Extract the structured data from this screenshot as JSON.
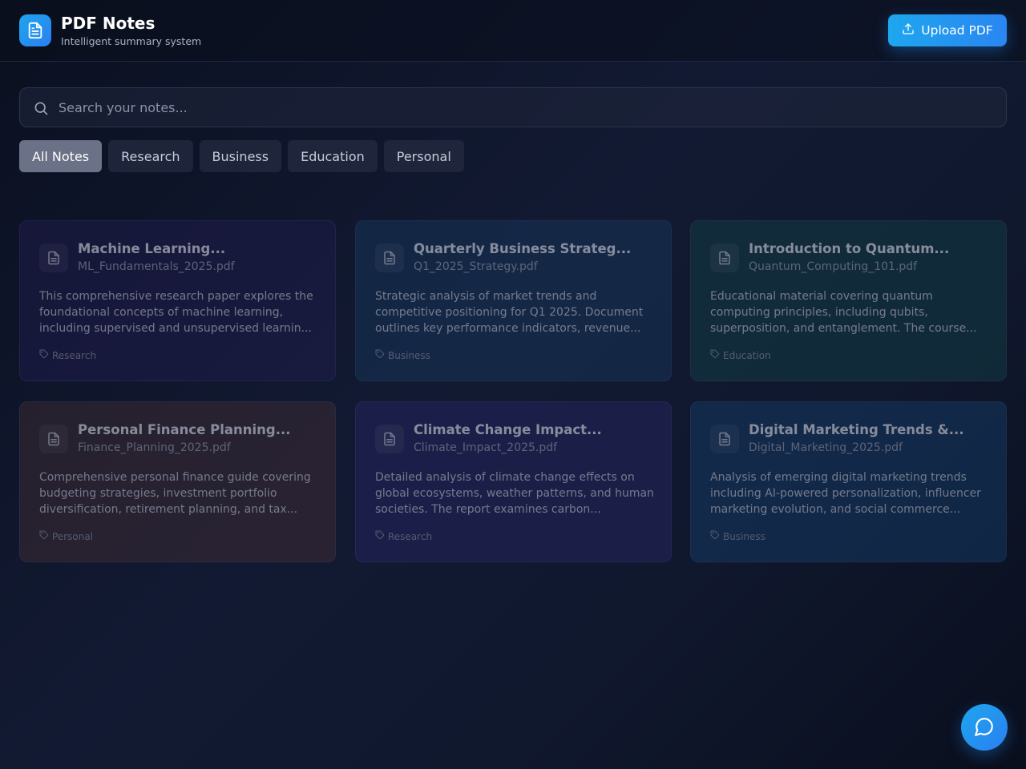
{
  "header": {
    "title": "PDF Notes",
    "subtitle": "Intelligent summary system",
    "upload_label": "Upload PDF",
    "logo_icon": "document-icon",
    "upload_icon": "upload-icon"
  },
  "search": {
    "placeholder": "Search your notes...",
    "value": "",
    "icon": "search-icon"
  },
  "filters": [
    {
      "label": "All Notes",
      "active": true
    },
    {
      "label": "Research",
      "active": false
    },
    {
      "label": "Business",
      "active": false
    },
    {
      "label": "Education",
      "active": false
    },
    {
      "label": "Personal",
      "active": false
    }
  ],
  "notes": [
    {
      "title": "Machine Learning...",
      "file": "ML_Fundamentals_2025.pdf",
      "description": "This comprehensive research paper explores the foundational concepts of machine learning, including supervised and unsupervised learnin...",
      "tag": "Research",
      "color": "#1e1c4a"
    },
    {
      "title": "Quarterly Business Strateg...",
      "file": "Q1_2025_Strategy.pdf",
      "description": "Strategic analysis of market trends and competitive positioning for Q1 2025. Document outlines key performance indicators, revenue...",
      "tag": "Business",
      "color": "#163457"
    },
    {
      "title": "Introduction to Quantum...",
      "file": "Quantum_Computing_101.pdf",
      "description": "Educational material covering quantum computing principles, including qubits, superposition, and entanglement. The course...",
      "tag": "Education",
      "color": "#123a44"
    },
    {
      "title": "Personal Finance Planning...",
      "file": "Finance_Planning_2025.pdf",
      "description": "Comprehensive personal finance guide covering budgeting strategies, investment portfolio diversification, retirement planning, and tax...",
      "tag": "Personal",
      "color": "#3a2a32"
    },
    {
      "title": "Climate Change Impact...",
      "file": "Climate_Impact_2025.pdf",
      "description": "Detailed analysis of climate change effects on global ecosystems, weather patterns, and human societies. The report examines carbon...",
      "tag": "Research",
      "color": "#24235a"
    },
    {
      "title": "Digital Marketing Trends &...",
      "file": "Digital_Marketing_2025.pdf",
      "description": "Analysis of emerging digital marketing trends including AI-powered personalization, influencer marketing evolution, and social commerce...",
      "tag": "Business",
      "color": "#143760"
    }
  ],
  "chat_icon": "chat-bubble-icon",
  "colors": {
    "accent": "#1ea6ee",
    "background": "#0b1020"
  }
}
